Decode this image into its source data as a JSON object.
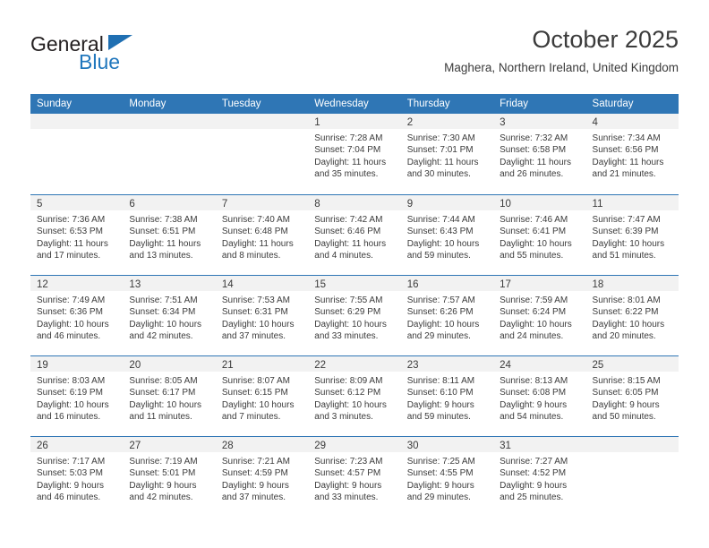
{
  "brand": {
    "name_top": "General",
    "name_bottom": "Blue",
    "triangle_color": "#1f6fb2",
    "blue_color": "#2077bd"
  },
  "header": {
    "title": "October 2025",
    "location": "Maghera, Northern Ireland, United Kingdom"
  },
  "theme": {
    "header_blue": "#2f76b5",
    "daynum_band": "#f2f2f2",
    "text": "#3b3b3b"
  },
  "calendar": {
    "weekday_headers": [
      "Sunday",
      "Monday",
      "Tuesday",
      "Wednesday",
      "Thursday",
      "Friday",
      "Saturday"
    ],
    "weeks": [
      [
        {
          "day": "",
          "sunrise": "",
          "sunset": "",
          "daylight": "",
          "empty": true
        },
        {
          "day": "",
          "sunrise": "",
          "sunset": "",
          "daylight": "",
          "empty": true
        },
        {
          "day": "",
          "sunrise": "",
          "sunset": "",
          "daylight": "",
          "empty": true
        },
        {
          "day": "1",
          "sunrise": "Sunrise: 7:28 AM",
          "sunset": "Sunset: 7:04 PM",
          "daylight": "Daylight: 11 hours and 35 minutes."
        },
        {
          "day": "2",
          "sunrise": "Sunrise: 7:30 AM",
          "sunset": "Sunset: 7:01 PM",
          "daylight": "Daylight: 11 hours and 30 minutes."
        },
        {
          "day": "3",
          "sunrise": "Sunrise: 7:32 AM",
          "sunset": "Sunset: 6:58 PM",
          "daylight": "Daylight: 11 hours and 26 minutes."
        },
        {
          "day": "4",
          "sunrise": "Sunrise: 7:34 AM",
          "sunset": "Sunset: 6:56 PM",
          "daylight": "Daylight: 11 hours and 21 minutes."
        }
      ],
      [
        {
          "day": "5",
          "sunrise": "Sunrise: 7:36 AM",
          "sunset": "Sunset: 6:53 PM",
          "daylight": "Daylight: 11 hours and 17 minutes."
        },
        {
          "day": "6",
          "sunrise": "Sunrise: 7:38 AM",
          "sunset": "Sunset: 6:51 PM",
          "daylight": "Daylight: 11 hours and 13 minutes."
        },
        {
          "day": "7",
          "sunrise": "Sunrise: 7:40 AM",
          "sunset": "Sunset: 6:48 PM",
          "daylight": "Daylight: 11 hours and 8 minutes."
        },
        {
          "day": "8",
          "sunrise": "Sunrise: 7:42 AM",
          "sunset": "Sunset: 6:46 PM",
          "daylight": "Daylight: 11 hours and 4 minutes."
        },
        {
          "day": "9",
          "sunrise": "Sunrise: 7:44 AM",
          "sunset": "Sunset: 6:43 PM",
          "daylight": "Daylight: 10 hours and 59 minutes."
        },
        {
          "day": "10",
          "sunrise": "Sunrise: 7:46 AM",
          "sunset": "Sunset: 6:41 PM",
          "daylight": "Daylight: 10 hours and 55 minutes."
        },
        {
          "day": "11",
          "sunrise": "Sunrise: 7:47 AM",
          "sunset": "Sunset: 6:39 PM",
          "daylight": "Daylight: 10 hours and 51 minutes."
        }
      ],
      [
        {
          "day": "12",
          "sunrise": "Sunrise: 7:49 AM",
          "sunset": "Sunset: 6:36 PM",
          "daylight": "Daylight: 10 hours and 46 minutes."
        },
        {
          "day": "13",
          "sunrise": "Sunrise: 7:51 AM",
          "sunset": "Sunset: 6:34 PM",
          "daylight": "Daylight: 10 hours and 42 minutes."
        },
        {
          "day": "14",
          "sunrise": "Sunrise: 7:53 AM",
          "sunset": "Sunset: 6:31 PM",
          "daylight": "Daylight: 10 hours and 37 minutes."
        },
        {
          "day": "15",
          "sunrise": "Sunrise: 7:55 AM",
          "sunset": "Sunset: 6:29 PM",
          "daylight": "Daylight: 10 hours and 33 minutes."
        },
        {
          "day": "16",
          "sunrise": "Sunrise: 7:57 AM",
          "sunset": "Sunset: 6:26 PM",
          "daylight": "Daylight: 10 hours and 29 minutes."
        },
        {
          "day": "17",
          "sunrise": "Sunrise: 7:59 AM",
          "sunset": "Sunset: 6:24 PM",
          "daylight": "Daylight: 10 hours and 24 minutes."
        },
        {
          "day": "18",
          "sunrise": "Sunrise: 8:01 AM",
          "sunset": "Sunset: 6:22 PM",
          "daylight": "Daylight: 10 hours and 20 minutes."
        }
      ],
      [
        {
          "day": "19",
          "sunrise": "Sunrise: 8:03 AM",
          "sunset": "Sunset: 6:19 PM",
          "daylight": "Daylight: 10 hours and 16 minutes."
        },
        {
          "day": "20",
          "sunrise": "Sunrise: 8:05 AM",
          "sunset": "Sunset: 6:17 PM",
          "daylight": "Daylight: 10 hours and 11 minutes."
        },
        {
          "day": "21",
          "sunrise": "Sunrise: 8:07 AM",
          "sunset": "Sunset: 6:15 PM",
          "daylight": "Daylight: 10 hours and 7 minutes."
        },
        {
          "day": "22",
          "sunrise": "Sunrise: 8:09 AM",
          "sunset": "Sunset: 6:12 PM",
          "daylight": "Daylight: 10 hours and 3 minutes."
        },
        {
          "day": "23",
          "sunrise": "Sunrise: 8:11 AM",
          "sunset": "Sunset: 6:10 PM",
          "daylight": "Daylight: 9 hours and 59 minutes."
        },
        {
          "day": "24",
          "sunrise": "Sunrise: 8:13 AM",
          "sunset": "Sunset: 6:08 PM",
          "daylight": "Daylight: 9 hours and 54 minutes."
        },
        {
          "day": "25",
          "sunrise": "Sunrise: 8:15 AM",
          "sunset": "Sunset: 6:05 PM",
          "daylight": "Daylight: 9 hours and 50 minutes."
        }
      ],
      [
        {
          "day": "26",
          "sunrise": "Sunrise: 7:17 AM",
          "sunset": "Sunset: 5:03 PM",
          "daylight": "Daylight: 9 hours and 46 minutes."
        },
        {
          "day": "27",
          "sunrise": "Sunrise: 7:19 AM",
          "sunset": "Sunset: 5:01 PM",
          "daylight": "Daylight: 9 hours and 42 minutes."
        },
        {
          "day": "28",
          "sunrise": "Sunrise: 7:21 AM",
          "sunset": "Sunset: 4:59 PM",
          "daylight": "Daylight: 9 hours and 37 minutes."
        },
        {
          "day": "29",
          "sunrise": "Sunrise: 7:23 AM",
          "sunset": "Sunset: 4:57 PM",
          "daylight": "Daylight: 9 hours and 33 minutes."
        },
        {
          "day": "30",
          "sunrise": "Sunrise: 7:25 AM",
          "sunset": "Sunset: 4:55 PM",
          "daylight": "Daylight: 9 hours and 29 minutes."
        },
        {
          "day": "31",
          "sunrise": "Sunrise: 7:27 AM",
          "sunset": "Sunset: 4:52 PM",
          "daylight": "Daylight: 9 hours and 25 minutes."
        },
        {
          "day": "",
          "sunrise": "",
          "sunset": "",
          "daylight": "",
          "empty": true
        }
      ]
    ]
  }
}
